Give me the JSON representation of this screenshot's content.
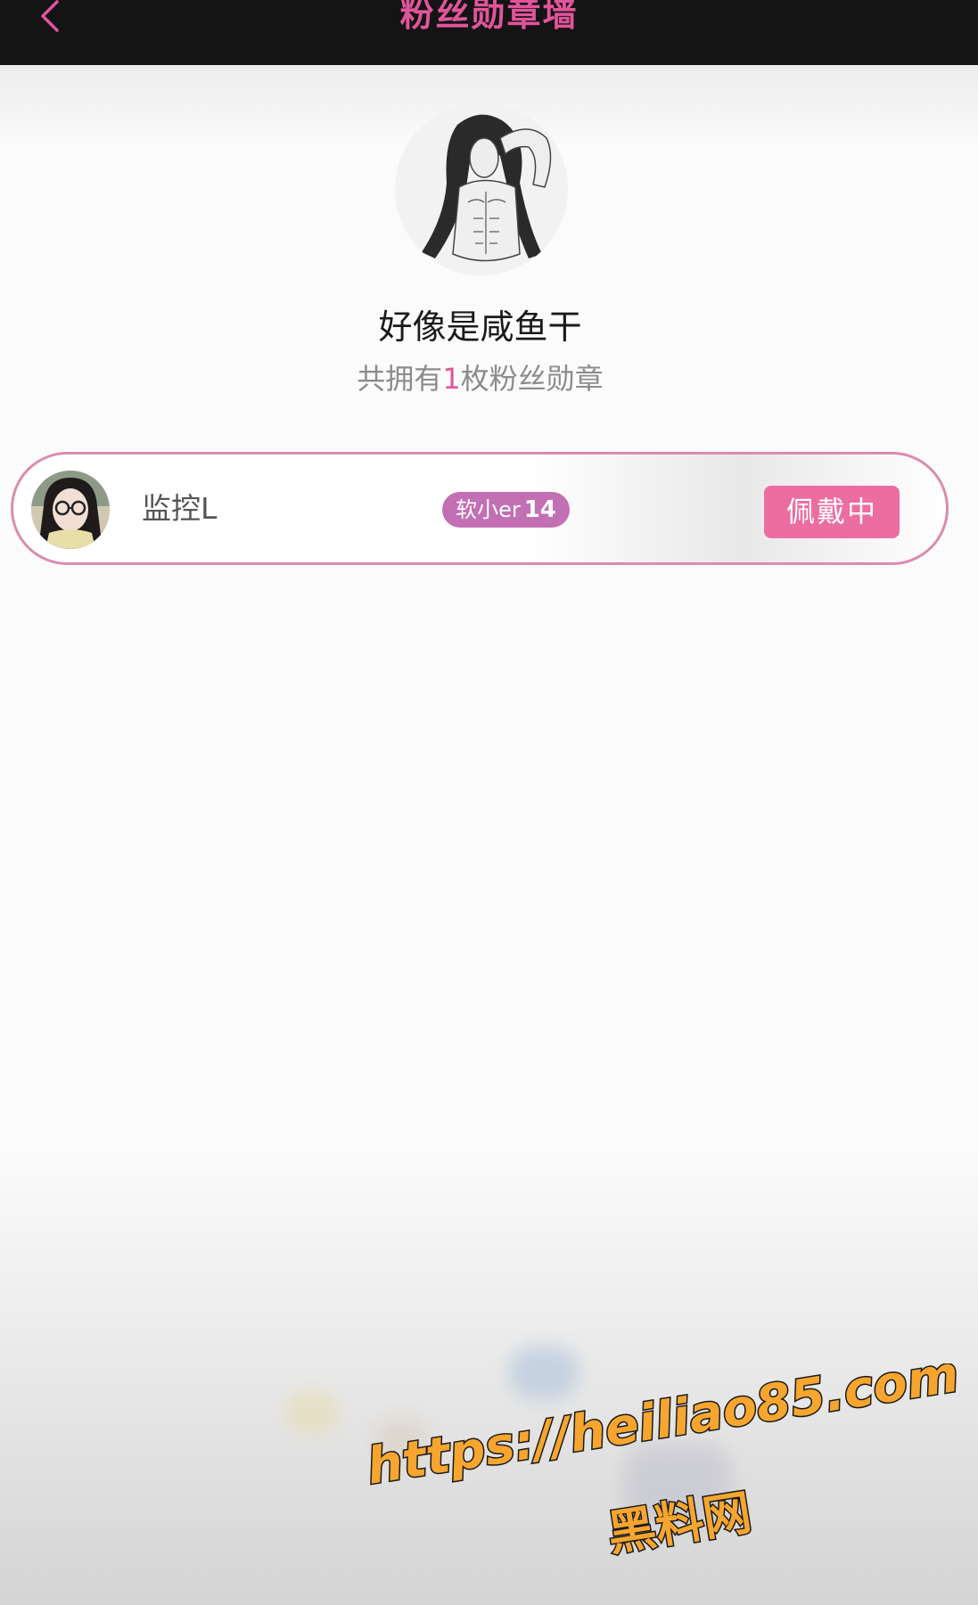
{
  "header": {
    "title": "粉丝勋章墙",
    "back_icon": "chevron-left-icon",
    "accent_color": "#e0559a"
  },
  "profile": {
    "nickname": "好像是咸鱼干",
    "summary_prefix": "共拥有",
    "medal_count": "1",
    "summary_suffix": "枚粉丝勋章"
  },
  "medals": [
    {
      "anchor_name": "监控L",
      "medal_name": "软小er",
      "medal_level": "14",
      "status_button": "佩戴中",
      "badge_color": "#c26fb4",
      "button_color": "#ec6d9f"
    }
  ],
  "watermark": {
    "url": "https://heiliao85.com",
    "text": "黑料网"
  }
}
